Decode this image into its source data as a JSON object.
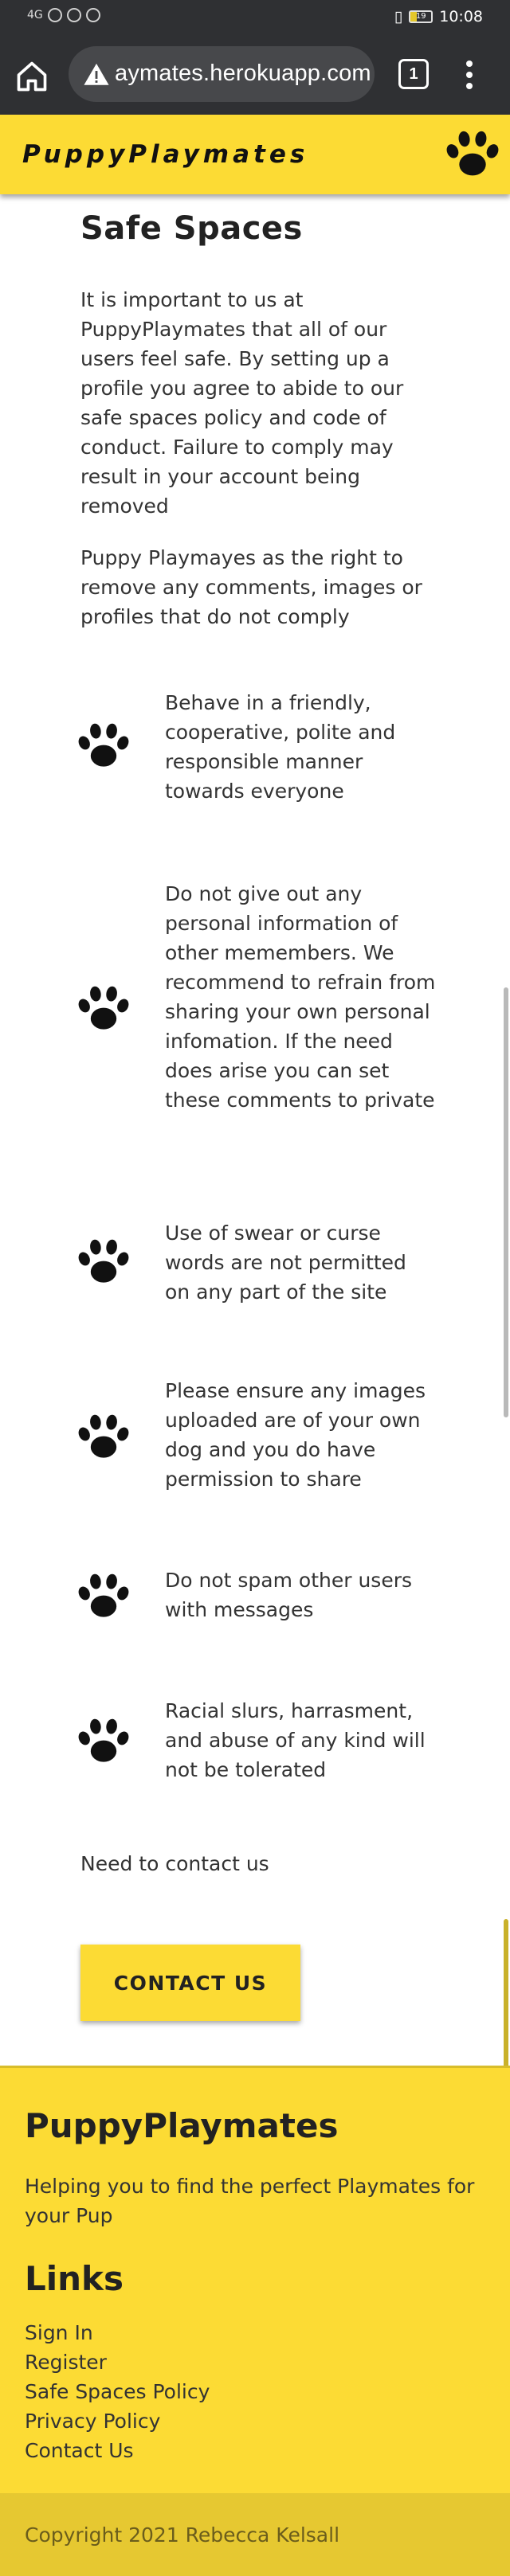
{
  "status_bar": {
    "network": "4G",
    "battery": "19",
    "time": "10:08"
  },
  "browser": {
    "url": "aymates.herokuapp.com",
    "tab_count": "1",
    "icons": {
      "home": "home-icon",
      "warning": "not-secure-warning-icon",
      "menu": "more-vert-icon"
    }
  },
  "header": {
    "brand": "PuppyPlaymates",
    "logo_icon": "paw-icon",
    "background": "#fcdb34"
  },
  "main": {
    "title": "Safe Spaces",
    "intro_paragraphs": [
      "It is important to us at PuppyPlaymates that all of our users feel safe. By setting up a profile you agree to abide to our safe spaces policy and code of conduct. Failure to comply may result in your account being removed",
      "Puppy Playmayes as the right to remove any comments, images or profiles that do not comply"
    ],
    "rules": [
      {
        "icon": "paw-icon",
        "text": "Behave in a friendly, cooperative, polite and responsible manner towards everyone"
      },
      {
        "icon": "paw-icon",
        "text": "Do not give out any personal information of other memembers. We recommend to refrain from sharing your own personal infomation. If the need does arise you can set these comments to private"
      },
      {
        "icon": "paw-icon",
        "text": "Use of swear or curse words are not permitted on any part of the site"
      },
      {
        "icon": "paw-icon",
        "text": "Please ensure any images uploaded are of your own dog and you do have permission to share"
      },
      {
        "icon": "paw-icon",
        "text": "Do not spam other users with messages"
      },
      {
        "icon": "paw-icon",
        "text": "Racial slurs, harrasment, and abuse of any kind will not be tolerated"
      }
    ],
    "contact_label": "Need to contact us",
    "contact_button": "CONTACT US"
  },
  "footer": {
    "brand": "PuppyPlaymates",
    "tagline": "Helping you to find the perfect Playmates for your Pup",
    "links_title": "Links",
    "links": [
      "Sign In",
      "Register",
      "Safe Spaces Policy",
      "Privacy Policy",
      "Contact Us"
    ],
    "copyright": "Copyright 2021 Rebecca Kelsall"
  }
}
